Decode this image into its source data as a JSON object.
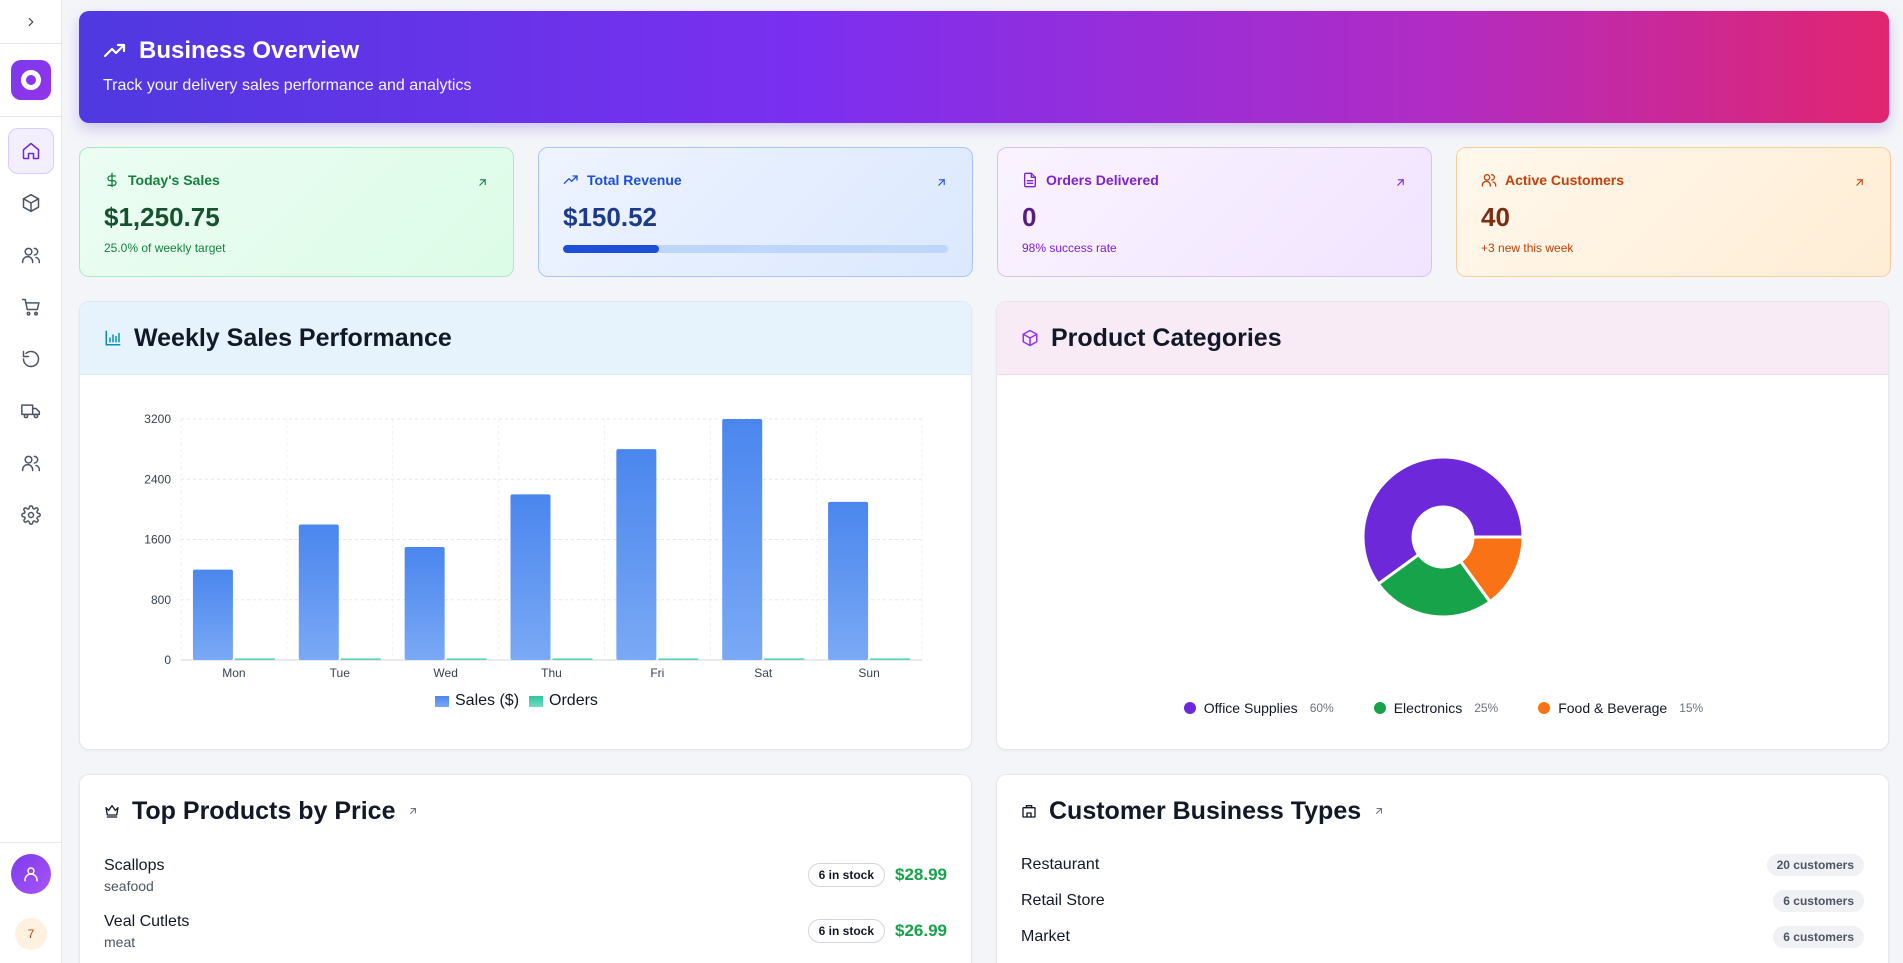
{
  "sidebar": {
    "toggle_icon": "chevron-right-icon",
    "nav": [
      {
        "icon": "home-icon",
        "active": true
      },
      {
        "icon": "box-icon"
      },
      {
        "icon": "users-icon"
      },
      {
        "icon": "cart-icon"
      },
      {
        "icon": "rotate-icon"
      },
      {
        "icon": "truck-icon"
      },
      {
        "icon": "users-icon"
      },
      {
        "icon": "gear-icon"
      }
    ],
    "badge": "7"
  },
  "hero": {
    "title": "Business Overview",
    "subtitle": "Track your delivery sales performance and analytics"
  },
  "stats": {
    "today_sales": {
      "label": "Today's Sales",
      "value": "$1,250.75",
      "sub": "25.0% of weekly target"
    },
    "total_revenue": {
      "label": "Total Revenue",
      "value": "$150.52",
      "progress": 0.25
    },
    "orders_delivered": {
      "label": "Orders Delivered",
      "value": "0",
      "sub": "98% success rate"
    },
    "active_customers": {
      "label": "Active Customers",
      "value": "40",
      "sub": "+3 new this week"
    }
  },
  "weekly": {
    "title": "Weekly Sales Performance",
    "legend_sales": "Sales ($)",
    "legend_orders": "Orders"
  },
  "categories": {
    "title": "Product Categories",
    "items": [
      {
        "name": "Office Supplies",
        "pct": "60%",
        "value": 60,
        "color": "#6d28d9"
      },
      {
        "name": "Electronics",
        "pct": "25%",
        "value": 25,
        "color": "#16a34a"
      },
      {
        "name": "Food & Beverage",
        "pct": "15%",
        "value": 15,
        "color": "#f97316"
      }
    ]
  },
  "top_products": {
    "title": "Top Products by Price",
    "items": [
      {
        "name": "Scallops",
        "category": "seafood",
        "stock": "6 in stock",
        "price": "$28.99"
      },
      {
        "name": "Veal Cutlets",
        "category": "meat",
        "stock": "6 in stock",
        "price": "$26.99"
      }
    ]
  },
  "customer_types": {
    "title": "Customer Business Types",
    "items": [
      {
        "name": "Restaurant",
        "count": "20 customers"
      },
      {
        "name": "Retail Store",
        "count": "6 customers"
      },
      {
        "name": "Market",
        "count": "6 customers"
      }
    ]
  },
  "colors": {
    "sales_bar": "#4a86ee",
    "orders_bar": "#2dc4a0",
    "accent": "#7c3aed"
  },
  "chart_data": {
    "type": "bar",
    "categories": [
      "Mon",
      "Tue",
      "Wed",
      "Thu",
      "Fri",
      "Sat",
      "Sun"
    ],
    "series": [
      {
        "name": "Sales ($)",
        "values": [
          1200,
          1800,
          1500,
          2200,
          2800,
          3200,
          2100
        ]
      },
      {
        "name": "Orders",
        "values": [
          0,
          0,
          0,
          0,
          0,
          0,
          0
        ]
      }
    ],
    "ylim": [
      0,
      3200
    ],
    "yticks": [
      0,
      800,
      1600,
      2400,
      3200
    ],
    "grid": true,
    "legend": "bottom-center"
  }
}
